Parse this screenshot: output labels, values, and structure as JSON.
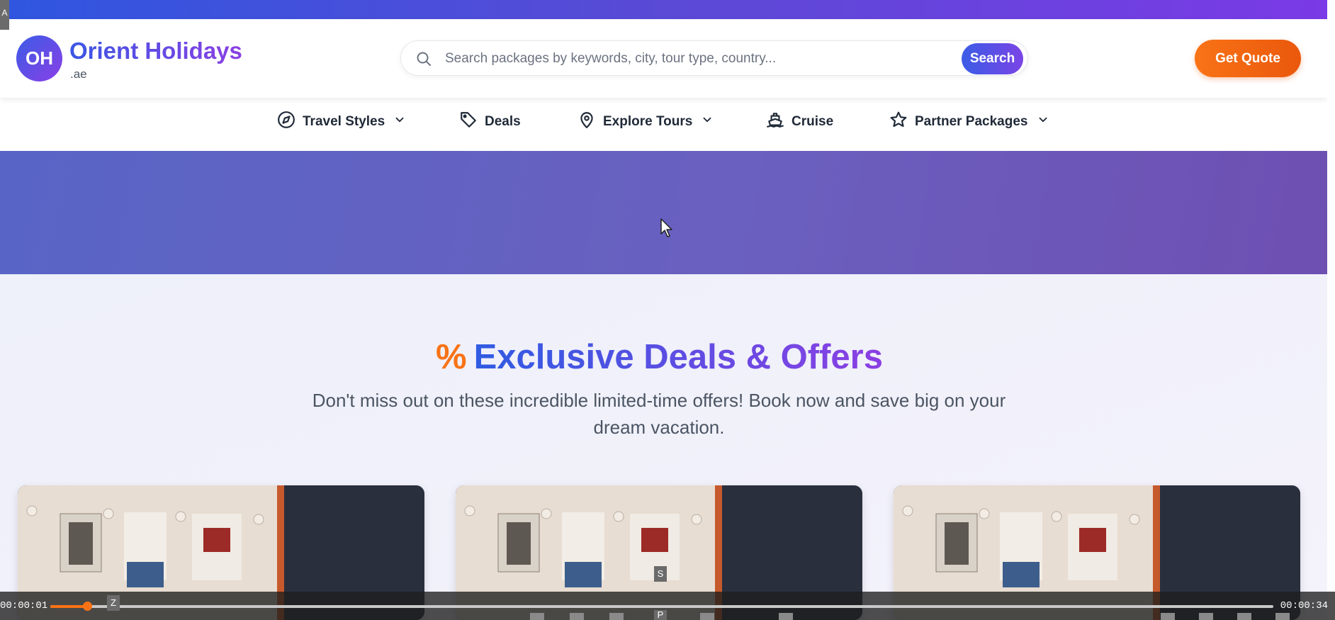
{
  "corner_tag": "A",
  "brand": {
    "initials": "OH",
    "name": "Orient Holidays",
    "tld": ".ae"
  },
  "search": {
    "placeholder": "Search packages by keywords, city, tour type, country...",
    "button": "Search"
  },
  "quote_button": "Get Quote",
  "nav": [
    {
      "label": "Travel Styles",
      "icon": "compass-icon",
      "dropdown": true
    },
    {
      "label": "Deals",
      "icon": "tag-icon",
      "dropdown": false
    },
    {
      "label": "Explore Tours",
      "icon": "map-pin-icon",
      "dropdown": true
    },
    {
      "label": "Cruise",
      "icon": "ship-icon",
      "dropdown": false
    },
    {
      "label": "Partner Packages",
      "icon": "star-icon",
      "dropdown": true
    }
  ],
  "deals": {
    "icon": "%",
    "title": "Exclusive Deals & Offers",
    "subtitle": "Don't miss out on these incredible limited-time offers! Book now and save big on your dream vacation."
  },
  "video": {
    "time_elapsed": "00:00:01",
    "time_total": "00:00:34",
    "progress": 0.03,
    "markers": [
      "Z",
      "S",
      "P"
    ]
  },
  "colors": {
    "brand_gradient_start": "#3b5ce6",
    "brand_gradient_end": "#8b3fe3",
    "accent_orange": "#f97316",
    "hero": "#6060c0"
  }
}
